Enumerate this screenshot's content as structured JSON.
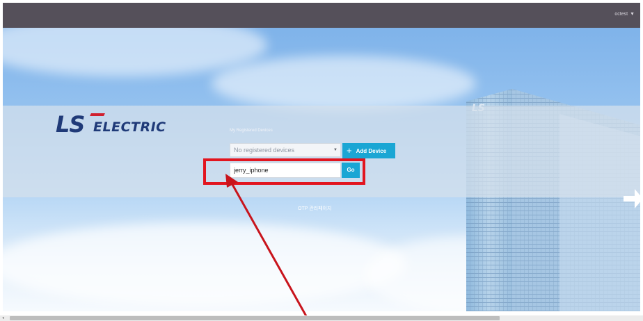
{
  "header": {
    "user_menu_label": "octest",
    "caret_icon": "caret-down-icon"
  },
  "brand": {
    "logo_ls": "LS",
    "logo_electric": "ELECTRIC",
    "brand_color": "#1f3a78",
    "accent_red": "#d0202f"
  },
  "devices": {
    "section_label": "My Registered Devices",
    "select_value": "No registered devices",
    "add_button_label": "Add Device",
    "add_icon": "plus-icon",
    "device_name_value": "jerry_iphone",
    "go_button_label": "Go",
    "button_color": "#1aa6d4"
  },
  "footer_links": {
    "otp_admin_label": "OTP 관리페이지"
  },
  "annotation": {
    "highlight_color": "#e2151f"
  }
}
